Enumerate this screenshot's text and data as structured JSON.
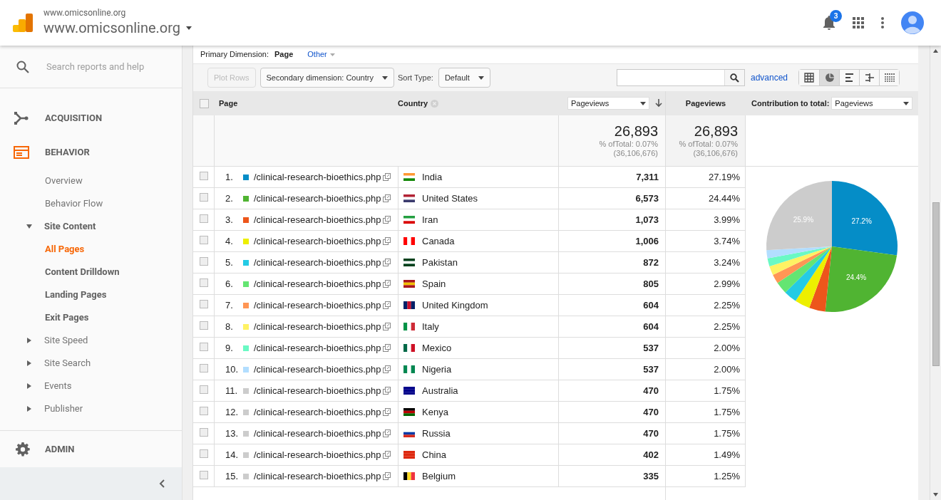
{
  "header": {
    "account_small": "www.omicsonline.org",
    "account_name": "www.omicsonline.org",
    "notifications": "3"
  },
  "sidebar": {
    "search_placeholder": "Search reports and help",
    "sections": [
      {
        "kind": "acquisition",
        "label": "ACQUISITION",
        "selected": false
      },
      {
        "kind": "behavior",
        "label": "BEHAVIOR",
        "selected": true
      }
    ],
    "items": [
      {
        "label": "Overview",
        "selected": false
      },
      {
        "label": "Behavior Flow",
        "selected": false
      },
      {
        "label": "Site Content",
        "expanded": true,
        "selected": false,
        "children": [
          {
            "label": "All Pages",
            "selected": true
          },
          {
            "label": "Content Drilldown",
            "selected": false
          },
          {
            "label": "Landing Pages",
            "selected": false
          },
          {
            "label": "Exit Pages",
            "selected": false
          }
        ]
      },
      {
        "label": "Site Speed",
        "expanded": false,
        "selected": false
      },
      {
        "label": "Site Search",
        "expanded": false,
        "selected": false
      },
      {
        "label": "Events",
        "expanded": false,
        "selected": false
      },
      {
        "label": "Publisher",
        "expanded": false,
        "selected": false
      }
    ],
    "admin": "ADMIN"
  },
  "toolbar": {
    "primary_label": "Primary Dimension:",
    "primary": "Page",
    "other": "Other",
    "plot_rows": {
      "label": "Plot Rows",
      "disabled": true
    },
    "secondary": "Secondary dimension: Country",
    "sort_label": "Sort Type:",
    "sort": "Default",
    "advanced": "advanced",
    "views": [
      {
        "kind": "table",
        "selected": false
      },
      {
        "kind": "pie",
        "selected": true
      },
      {
        "kind": "bars",
        "selected": false
      },
      {
        "kind": "compare",
        "selected": false
      },
      {
        "kind": "pivot",
        "selected": false
      }
    ]
  },
  "table": {
    "columns": [
      "Page",
      "Country"
    ],
    "metric_select": "Pageviews",
    "metric_column": "Pageviews",
    "contribution_label": "Contribution to total:",
    "contribution_select": "Pageviews",
    "totals": [
      {
        "value": "26,893",
        "percent": "% ofTotal: 0.07%",
        "total": "(36,106,676)"
      },
      {
        "value": "26,893",
        "percent": "% ofTotal: 0.07%",
        "total": "(36,106,676)"
      }
    ],
    "rows": [
      {
        "index": "1.",
        "color": "#058dc7",
        "page": "/clinical-research-bioethics.php",
        "country": "India",
        "pageviews": "7,311",
        "share": "27.19%",
        "checked": false
      },
      {
        "index": "2.",
        "color": "#50b432",
        "page": "/clinical-research-bioethics.php",
        "country": "United States",
        "pageviews": "6,573",
        "share": "24.44%",
        "checked": false
      },
      {
        "index": "3.",
        "color": "#ed561b",
        "page": "/clinical-research-bioethics.php",
        "country": "Iran",
        "pageviews": "1,073",
        "share": "3.99%",
        "checked": false
      },
      {
        "index": "4.",
        "color": "#edef00",
        "page": "/clinical-research-bioethics.php",
        "country": "Canada",
        "pageviews": "1,006",
        "share": "3.74%",
        "checked": false
      },
      {
        "index": "5.",
        "color": "#24cbe5",
        "page": "/clinical-research-bioethics.php",
        "country": "Pakistan",
        "pageviews": "872",
        "share": "3.24%",
        "checked": false
      },
      {
        "index": "6.",
        "color": "#64e572",
        "page": "/clinical-research-bioethics.php",
        "country": "Spain",
        "pageviews": "805",
        "share": "2.99%",
        "checked": false
      },
      {
        "index": "7.",
        "color": "#ff9655",
        "page": "/clinical-research-bioethics.php",
        "country": "United Kingdom",
        "pageviews": "604",
        "share": "2.25%",
        "checked": false
      },
      {
        "index": "8.",
        "color": "#fff263",
        "page": "/clinical-research-bioethics.php",
        "country": "Italy",
        "pageviews": "604",
        "share": "2.25%",
        "checked": false
      },
      {
        "index": "9.",
        "color": "#6af9c4",
        "page": "/clinical-research-bioethics.php",
        "country": "Mexico",
        "pageviews": "537",
        "share": "2.00%",
        "checked": false
      },
      {
        "index": "10.",
        "color": "#b2deff",
        "page": "/clinical-research-bioethics.php",
        "country": "Nigeria",
        "pageviews": "537",
        "share": "2.00%",
        "checked": false
      },
      {
        "index": "11.",
        "color": "#cccccc",
        "page": "/clinical-research-bioethics.php",
        "country": "Australia",
        "pageviews": "470",
        "share": "1.75%",
        "checked": false
      },
      {
        "index": "12.",
        "color": "#cccccc",
        "page": "/clinical-research-bioethics.php",
        "country": "Kenya",
        "pageviews": "470",
        "share": "1.75%",
        "checked": false
      },
      {
        "index": "13.",
        "color": "#cccccc",
        "page": "/clinical-research-bioethics.php",
        "country": "Russia",
        "pageviews": "470",
        "share": "1.75%",
        "checked": false
      },
      {
        "index": "14.",
        "color": "#cccccc",
        "page": "/clinical-research-bioethics.php",
        "country": "China",
        "pageviews": "402",
        "share": "1.49%",
        "checked": false
      },
      {
        "index": "15.",
        "color": "#cccccc",
        "page": "/clinical-research-bioethics.php",
        "country": "Belgium",
        "pageviews": "335",
        "share": "1.25%",
        "checked": false
      }
    ],
    "chart_data": {
      "type": "pie",
      "values": [
        27.19,
        24.44,
        3.99,
        3.74,
        3.24,
        2.99,
        2.25,
        2.25,
        2.0,
        2.0,
        25.91
      ],
      "value_labels": [
        "27.2%",
        "24.4%",
        null,
        null,
        null,
        null,
        null,
        null,
        null,
        null,
        "25.9%"
      ]
    }
  },
  "select_all": {
    "checked": false
  }
}
